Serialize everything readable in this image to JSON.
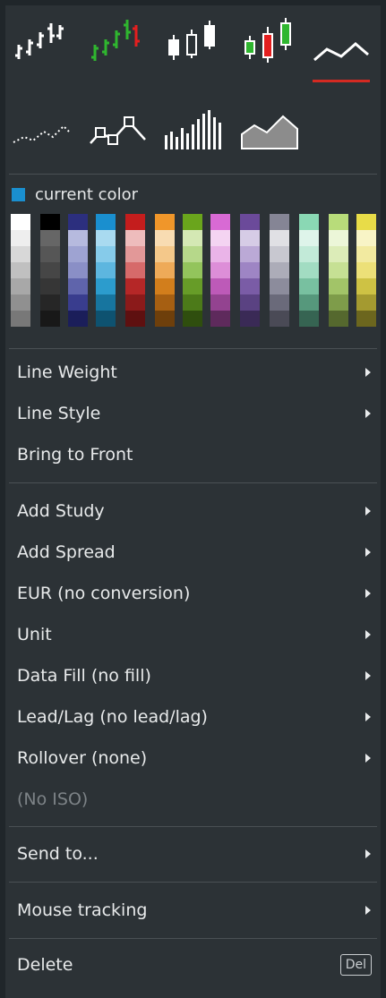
{
  "chart_types": [
    {
      "name": "hlc-bar",
      "selected": false
    },
    {
      "name": "hlc-bar-colored",
      "selected": false
    },
    {
      "name": "candlestick",
      "selected": false
    },
    {
      "name": "candlestick-colored",
      "selected": false
    },
    {
      "name": "line",
      "selected": true
    },
    {
      "name": "dotted-line",
      "selected": false
    },
    {
      "name": "line-with-markers",
      "selected": false
    },
    {
      "name": "volume-histogram",
      "selected": false
    },
    {
      "name": "area",
      "selected": false
    }
  ],
  "colors": {
    "accent_selected": "#d42a22",
    "current_color": "#1a8fcf",
    "menu_bg": "#2c3236",
    "text": "#e8eaeb",
    "text_disabled": "#7d8387",
    "up_green": "#2fb62f",
    "down_red": "#e41f1f"
  },
  "current_color_label": "current color",
  "palette": [
    [
      "#ffffff",
      "#eeeeee",
      "#d8d8d8",
      "#c0c0c0",
      "#a8a8a8",
      "#909090",
      "#787878"
    ],
    [
      "#000000",
      "#666666",
      "#565656",
      "#464646",
      "#363636",
      "#262626",
      "#181818"
    ],
    [
      "#2c2f7e",
      "#b6bade",
      "#9ea3d2",
      "#8a8fc6",
      "#5f64ab",
      "#393d8e",
      "#1b1e5a"
    ],
    [
      "#1a8fcf",
      "#a9daf0",
      "#86cbea",
      "#5db6df",
      "#2c9ccd",
      "#17759f",
      "#0e5270"
    ],
    [
      "#c41d1d",
      "#eebcbc",
      "#e29898",
      "#d66a6a",
      "#b52727",
      "#8b1a1a",
      "#5e1010"
    ],
    [
      "#f0962a",
      "#f8dcb2",
      "#f4c88a",
      "#eeaa58",
      "#d27e1c",
      "#a65f12",
      "#6e3f0b"
    ],
    [
      "#6aa51c",
      "#d4e8b4",
      "#b6d88a",
      "#93c45c",
      "#679c28",
      "#4c7a19",
      "#2f4e0e"
    ],
    [
      "#d86ad4",
      "#f4d4f2",
      "#eab4e8",
      "#dd8ed8",
      "#bd5ab8",
      "#934390",
      "#5e2a5c"
    ],
    [
      "#6b4a9a",
      "#d6cce6",
      "#bba9d6",
      "#9e85c4",
      "#7a5ca6",
      "#5a4282",
      "#3a2a56"
    ],
    [
      "#858595",
      "#e0e0e4",
      "#c8c8d0",
      "#acacb8",
      "#8c8c9c",
      "#6a6a7a",
      "#4a4a56"
    ],
    [
      "#8ad8b4",
      "#def4ea",
      "#c2ead8",
      "#a2dcc2",
      "#78c0a0",
      "#56987c",
      "#366452"
    ],
    [
      "#b8dc7a",
      "#ecf6d8",
      "#dcecb8",
      "#c6e094",
      "#a2c468",
      "#7e9c4a",
      "#55682e"
    ],
    [
      "#e8dc48",
      "#f8f4c6",
      "#f2eaa0",
      "#ece078",
      "#cec244",
      "#a49a30",
      "#6c661e"
    ]
  ],
  "menu": {
    "line_weight": "Line Weight",
    "line_style": "Line Style",
    "bring_to_front": "Bring to Front",
    "add_study": "Add Study",
    "add_spread": "Add Spread",
    "currency": "EUR (no conversion)",
    "unit": "Unit",
    "data_fill": "Data Fill (no fill)",
    "lead_lag": "Lead/Lag (no lead/lag)",
    "rollover": "Rollover (none)",
    "no_iso": "(No ISO)",
    "send_to": "Send to...",
    "mouse_tracking": "Mouse tracking",
    "delete": "Delete",
    "delete_shortcut": "Del"
  }
}
